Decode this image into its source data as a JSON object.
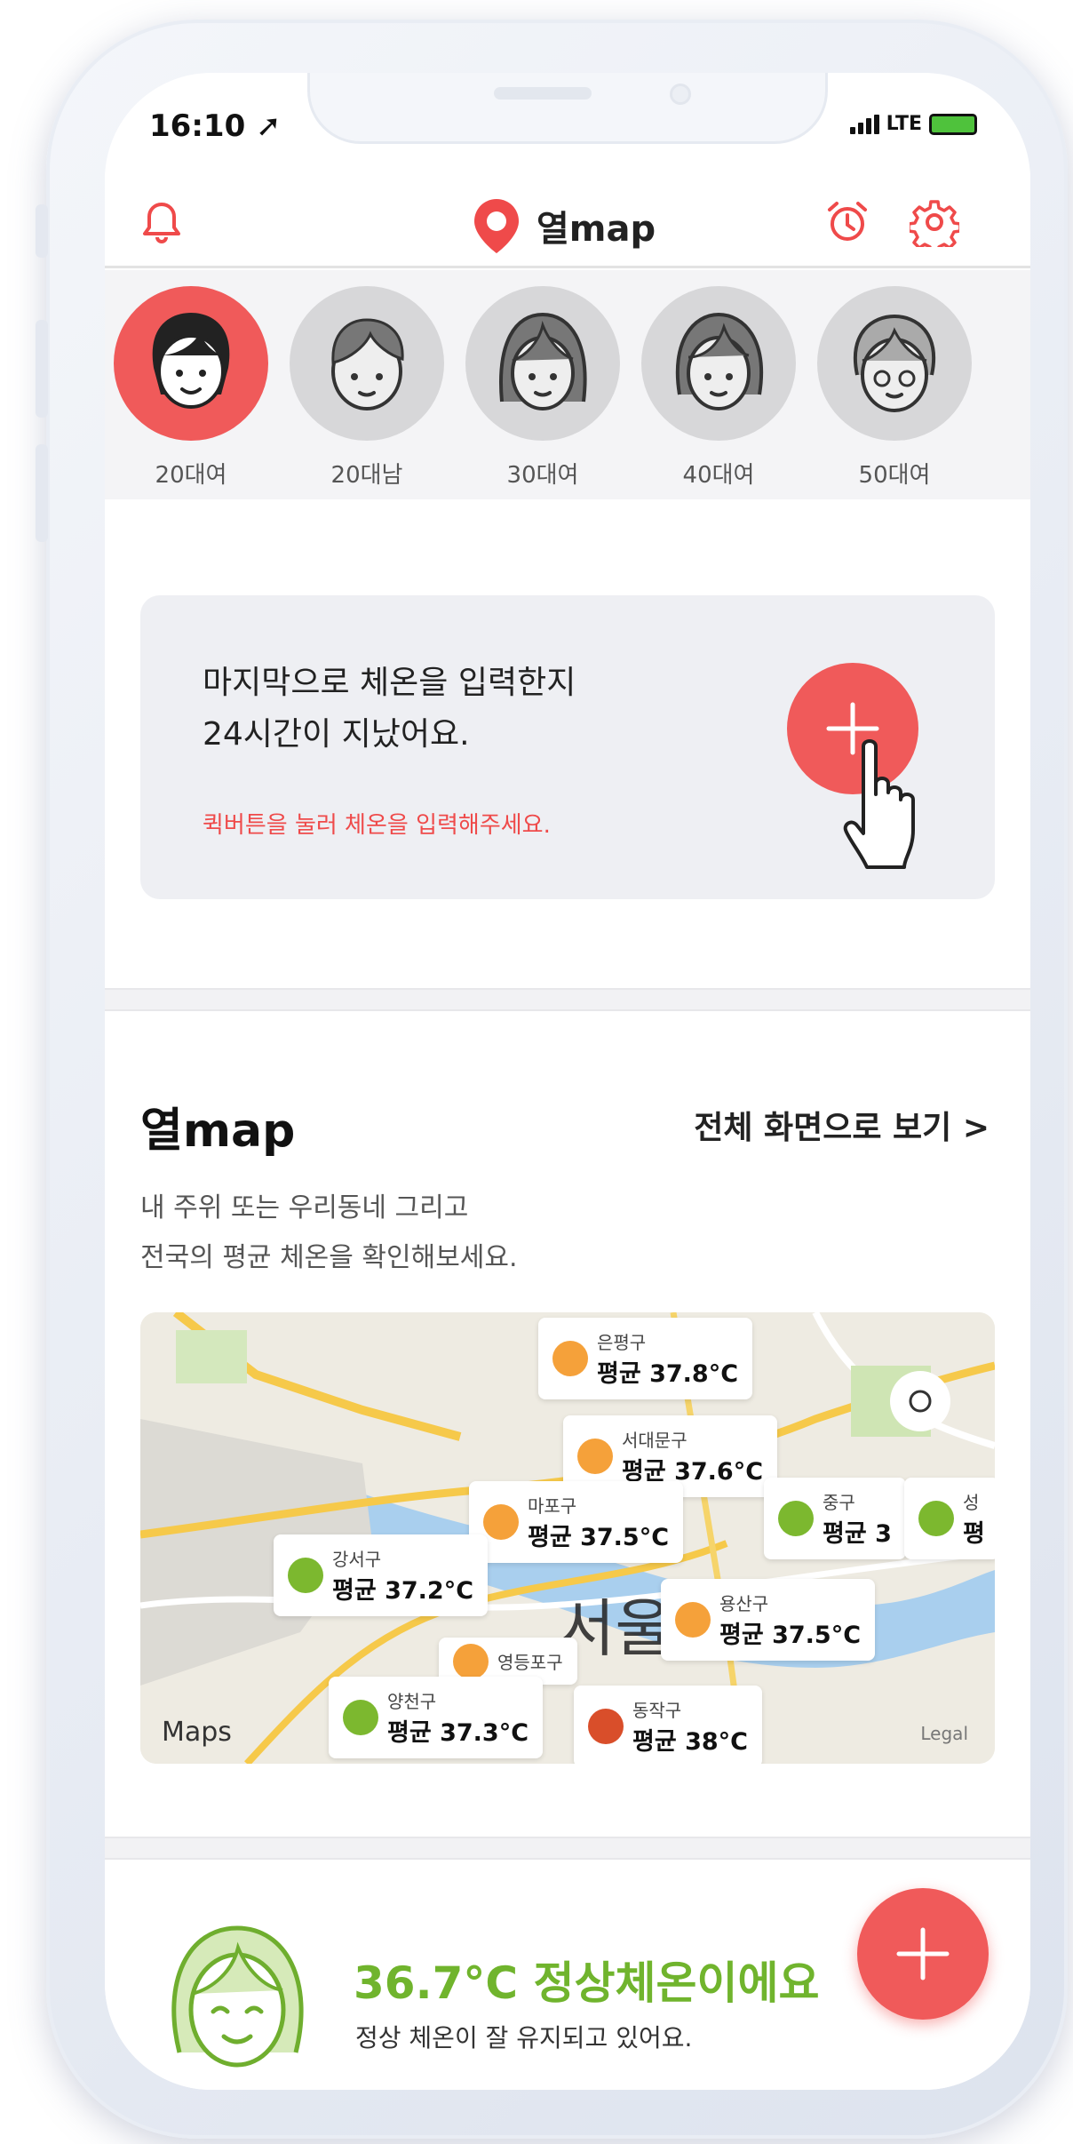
{
  "status": {
    "time": "16:10",
    "network": "LTE"
  },
  "header": {
    "logo_text": "열map"
  },
  "avatars": [
    {
      "label": "20대여",
      "selected": true
    },
    {
      "label": "20대남",
      "selected": false
    },
    {
      "label": "30대여",
      "selected": false
    },
    {
      "label": "40대여",
      "selected": false
    },
    {
      "label": "50대여",
      "selected": false
    }
  ],
  "reminder": {
    "line1": "마지막으로 체온을 입력한지",
    "line2": "24시간이 지났어요.",
    "hint": "퀵버튼을 눌러 체온을 입력해주세요."
  },
  "map_section": {
    "title": "열map",
    "fullscreen_link": "전체 화면으로 보기 >",
    "desc1": "내 주위 또는 우리동네 그리고",
    "desc2": "전국의 평균 체온을 확인해보세요.",
    "city_label": "서울",
    "maps_logo": "Maps",
    "legal": "Legal",
    "pins": [
      {
        "name": "은평구",
        "value": "평균 37.8°C",
        "color": "#f5a13a"
      },
      {
        "name": "서대문구",
        "value": "평균 37.6°C",
        "color": "#f5a13a"
      },
      {
        "name": "마포구",
        "value": "평균 37.5°C",
        "color": "#f5a13a"
      },
      {
        "name": "강서구",
        "value": "평균 37.2°C",
        "color": "#7cb82f"
      },
      {
        "name": "중구",
        "value": "평균 3",
        "color": "#7cb82f"
      },
      {
        "name": "성",
        "value": "평",
        "color": "#7cb82f"
      },
      {
        "name": "용산구",
        "value": "평균 37.5°C",
        "color": "#f5a13a"
      },
      {
        "name": "영등포구",
        "value": "",
        "color": "#f5a13a"
      },
      {
        "name": "양천구",
        "value": "평균 37.3°C",
        "color": "#7cb82f"
      },
      {
        "name": "동작구",
        "value": "평균 38°C",
        "color": "#d94e2a"
      }
    ]
  },
  "status_card": {
    "temp": "36.7°C 정상체온이에요",
    "sub": "정상 체온이 잘 유지되고 있어요."
  },
  "colors": {
    "accent": "#ef4a4a",
    "normal": "#70b42d"
  }
}
